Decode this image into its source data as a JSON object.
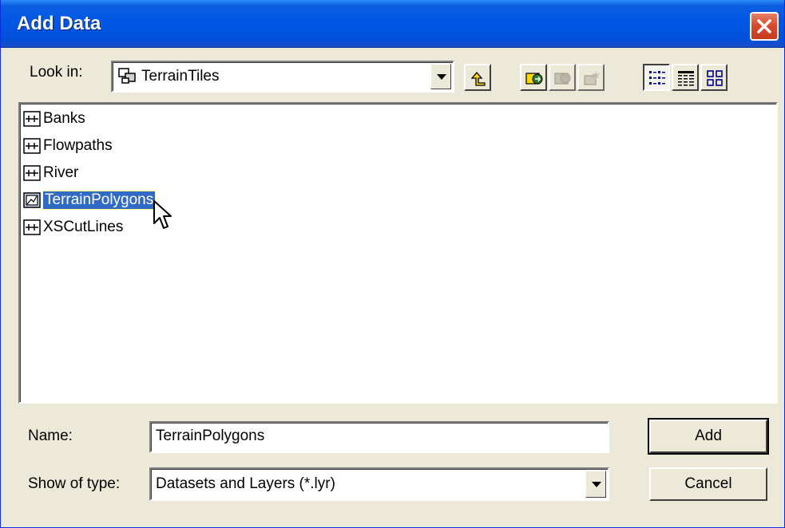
{
  "window": {
    "title": "Add Data"
  },
  "toolbar": {
    "look_in_label": "Look in:",
    "look_in_value": "TerrainTiles",
    "buttons": [
      {
        "icon": "up-one-level-icon",
        "enabled": true
      },
      {
        "icon": "connect-to-folder-icon",
        "enabled": true
      },
      {
        "icon": "disconnect-from-folder-icon",
        "enabled": false
      },
      {
        "icon": "new-item-icon",
        "enabled": false
      },
      {
        "icon": "list-view-icon",
        "enabled": true
      },
      {
        "icon": "details-view-icon",
        "enabled": true
      },
      {
        "icon": "thumbnails-view-icon",
        "enabled": true
      }
    ]
  },
  "files": [
    {
      "name": "Banks",
      "icon": "polyline-layer-icon",
      "selected": false
    },
    {
      "name": "Flowpaths",
      "icon": "polyline-layer-icon",
      "selected": false
    },
    {
      "name": "River",
      "icon": "polyline-layer-icon",
      "selected": false
    },
    {
      "name": "TerrainPolygons",
      "icon": "polygon-layer-icon",
      "selected": true
    },
    {
      "name": "XSCutLines",
      "icon": "polyline-layer-icon",
      "selected": false
    }
  ],
  "form": {
    "name_label": "Name:",
    "name_value": "TerrainPolygons",
    "type_label": "Show of type:",
    "type_value": "Datasets and Layers (*.lyr)"
  },
  "buttons": {
    "add": "Add",
    "cancel": "Cancel"
  },
  "colors": {
    "title_bar": "#0056e6",
    "selection": "#316ac5",
    "dialog_bg": "#ece9d8",
    "close": "#d9472b"
  }
}
